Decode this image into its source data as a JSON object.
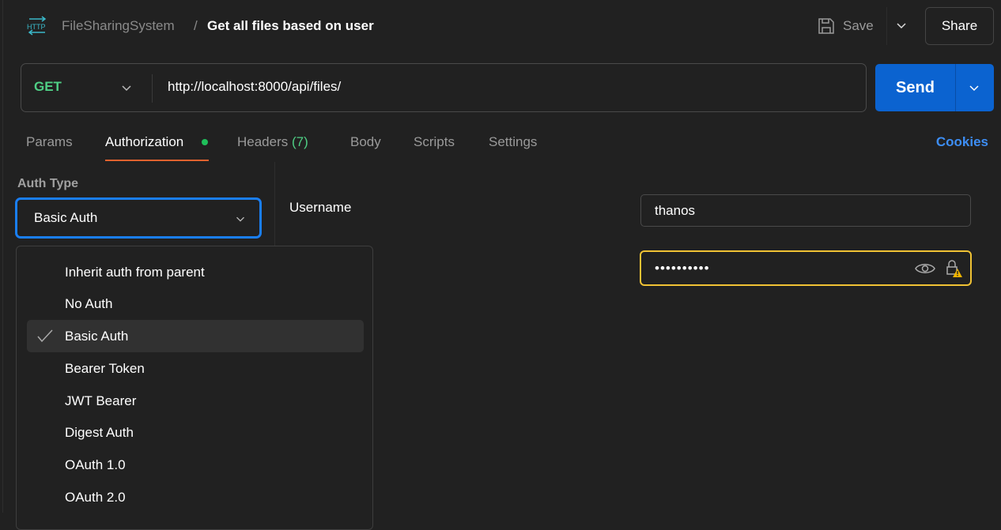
{
  "header": {
    "collection": "FileSharingSystem",
    "separator": "/",
    "request_title": "Get all files based on user",
    "save_label": "Save",
    "share_label": "Share"
  },
  "request": {
    "method": "GET",
    "url": "http://localhost:8000/api/files/",
    "send_label": "Send"
  },
  "tabs": [
    {
      "label": "Params"
    },
    {
      "label": "Authorization"
    },
    {
      "label": "Headers",
      "count": "(7)"
    },
    {
      "label": "Body"
    },
    {
      "label": "Scripts"
    },
    {
      "label": "Settings"
    }
  ],
  "cookies_label": "Cookies",
  "auth": {
    "type_label": "Auth Type",
    "selected": "Basic Auth",
    "options": [
      "Inherit auth from parent",
      "No Auth",
      "Basic Auth",
      "Bearer Token",
      "JWT Bearer",
      "Digest Auth",
      "OAuth 1.0",
      "OAuth 2.0"
    ],
    "username_label": "Username",
    "username_value": "thanos",
    "password_masked": "••••••••••"
  },
  "colors": {
    "accent": "#0b63d0",
    "method_get": "#4fcf85",
    "warning_border": "#f0c234",
    "tab_underline": "#e0622e",
    "link": "#3d8ef5"
  }
}
